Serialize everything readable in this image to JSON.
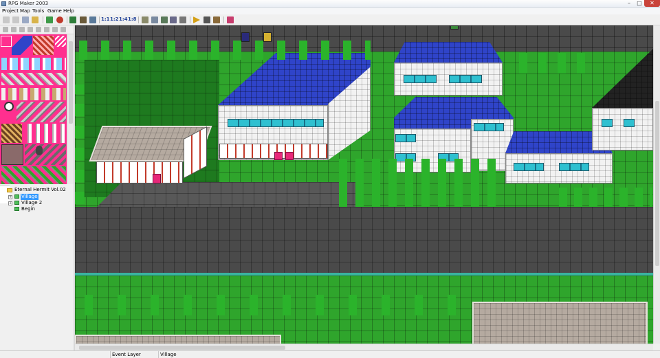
{
  "window": {
    "title": "RPG Maker 2003"
  },
  "menu": [
    "Project",
    "Map",
    "Tools",
    "Game",
    "Help"
  ],
  "toolbar": {
    "zoom_buttons": [
      "1:1",
      "1:2",
      "1:4",
      "1:8"
    ]
  },
  "project_tree": {
    "root": "Eternal Hermit Vol.02",
    "items": [
      {
        "label": "Village",
        "selected": true
      },
      {
        "label": "Village 2",
        "selected": false
      },
      {
        "label": "Begin",
        "selected": false
      }
    ]
  },
  "statusbar": {
    "mode": "Event Layer",
    "map_name": "Village"
  },
  "colors": {
    "chipset_bg": "#ff2f8f",
    "grass": "#2fa52c",
    "roof_blue": "#2f44c9",
    "road": "#4a4a4a",
    "selection": "#3399ff"
  }
}
